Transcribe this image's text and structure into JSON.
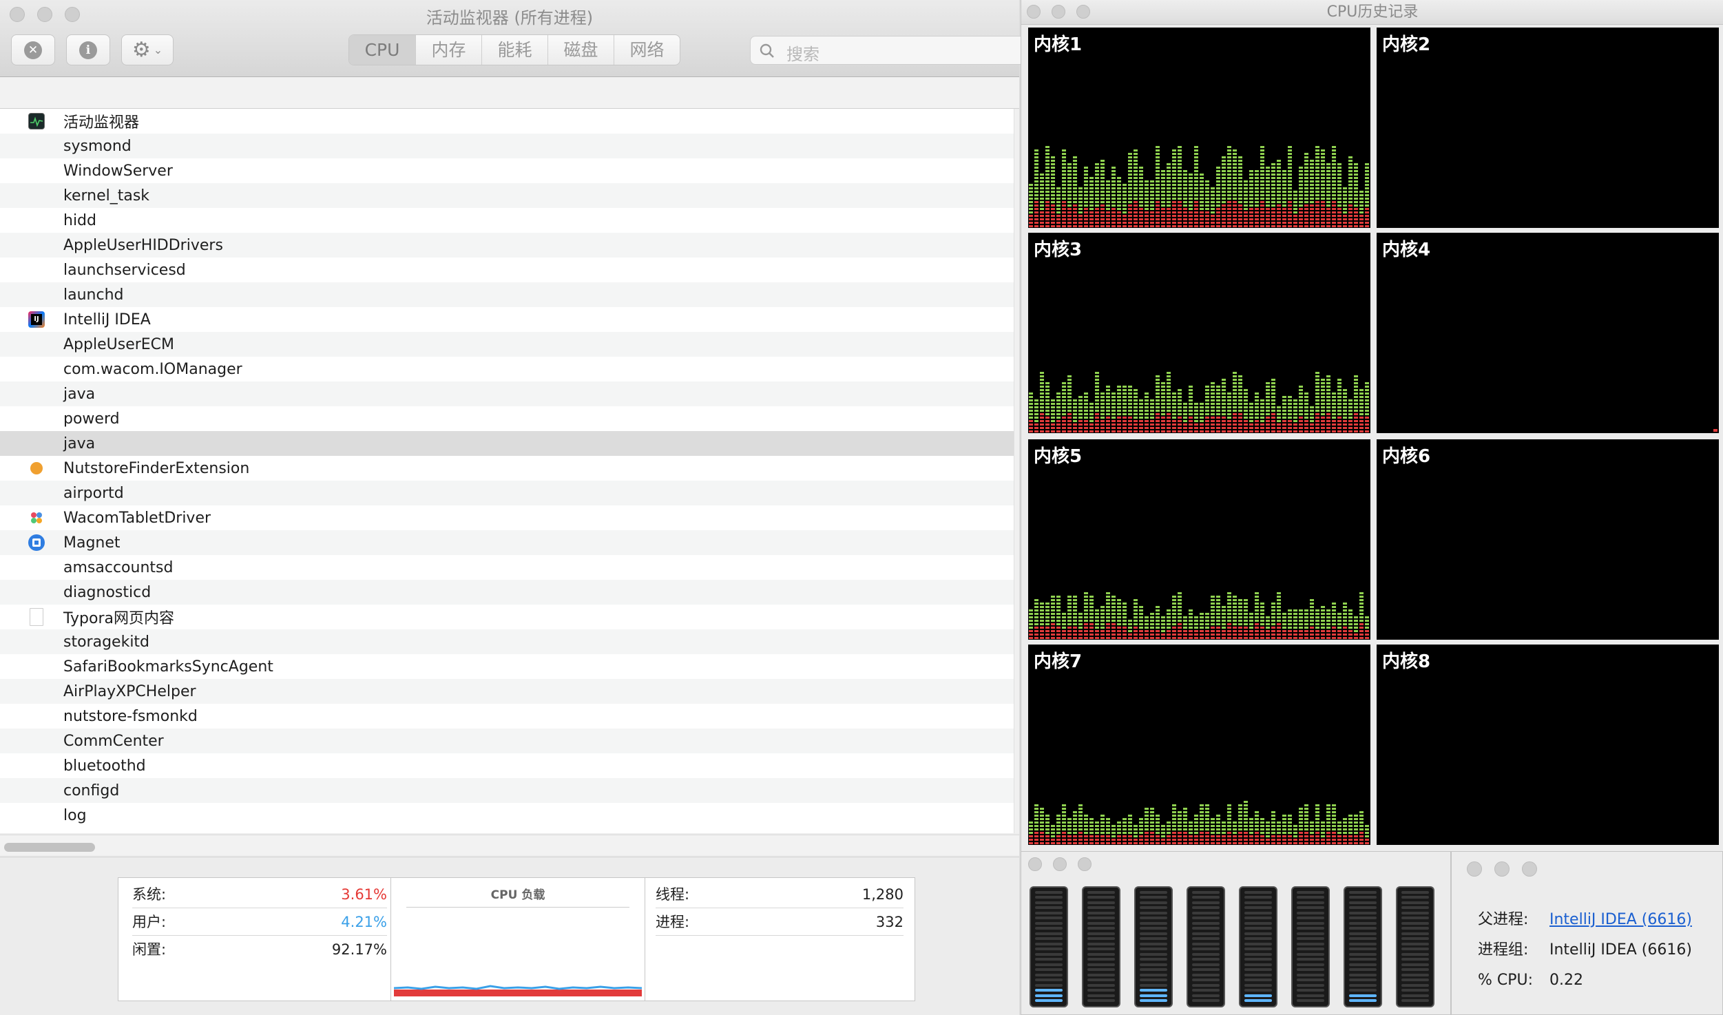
{
  "main_window": {
    "title": "活动监视器 (所有进程)",
    "tabs": [
      {
        "label": "CPU",
        "active": true
      },
      {
        "label": "内存",
        "active": false
      },
      {
        "label": "能耗",
        "active": false
      },
      {
        "label": "磁盘",
        "active": false
      },
      {
        "label": "网络",
        "active": false
      }
    ],
    "search_placeholder": "搜索",
    "processes": [
      {
        "name": "活动监视器",
        "icon": "activity-monitor-icon"
      },
      {
        "name": "sysmond",
        "icon": ""
      },
      {
        "name": "WindowServer",
        "icon": ""
      },
      {
        "name": "kernel_task",
        "icon": ""
      },
      {
        "name": "hidd",
        "icon": ""
      },
      {
        "name": "AppleUserHIDDrivers",
        "icon": ""
      },
      {
        "name": "launchservicesd",
        "icon": ""
      },
      {
        "name": "launchd",
        "icon": ""
      },
      {
        "name": "IntelliJ IDEA",
        "icon": "intellij-icon"
      },
      {
        "name": "AppleUserECM",
        "icon": ""
      },
      {
        "name": "com.wacom.IOManager",
        "icon": ""
      },
      {
        "name": "java",
        "icon": ""
      },
      {
        "name": "powerd",
        "icon": ""
      },
      {
        "name": "java",
        "icon": "",
        "selected": true
      },
      {
        "name": "NutstoreFinderExtension",
        "icon": "nutstore-icon"
      },
      {
        "name": "airportd",
        "icon": ""
      },
      {
        "name": "WacomTabletDriver",
        "icon": "wacom-icon"
      },
      {
        "name": "Magnet",
        "icon": "magnet-icon"
      },
      {
        "name": "amsaccountsd",
        "icon": ""
      },
      {
        "name": "diagnosticd",
        "icon": ""
      },
      {
        "name": "Typora网页内容",
        "icon": "document-icon"
      },
      {
        "name": "storagekitd",
        "icon": ""
      },
      {
        "name": "SafariBookmarksSyncAgent",
        "icon": ""
      },
      {
        "name": "AirPlayXPCHelper",
        "icon": ""
      },
      {
        "name": "nutstore-fsmonkd",
        "icon": ""
      },
      {
        "name": "CommCenter",
        "icon": ""
      },
      {
        "name": "bluetoothd",
        "icon": ""
      },
      {
        "name": "configd",
        "icon": ""
      },
      {
        "name": "log",
        "icon": ""
      }
    ],
    "stats": {
      "system_label": "系统:",
      "system_value": "3.61%",
      "user_label": "用户:",
      "user_value": "4.21%",
      "idle_label": "闲置:",
      "idle_value": "92.17%",
      "cpu_load_title": "CPU 负载",
      "threads_label": "线程:",
      "threads_value": "1,280",
      "processes_label": "进程:",
      "processes_value": "332"
    }
  },
  "cpu_history": {
    "title": "CPU历史记录",
    "cores": [
      {
        "label": "内核1",
        "active": true,
        "level": 0.3
      },
      {
        "label": "内核2",
        "active": false,
        "level": 0
      },
      {
        "label": "内核3",
        "active": true,
        "level": 0.22
      },
      {
        "label": "内核4",
        "active": false,
        "level": 0
      },
      {
        "label": "内核5",
        "active": true,
        "level": 0.17
      },
      {
        "label": "内核6",
        "active": false,
        "level": 0
      },
      {
        "label": "内核7",
        "active": true,
        "level": 0.15
      },
      {
        "label": "内核8",
        "active": false,
        "level": 0
      }
    ]
  },
  "cpu_meter": {
    "levels": [
      0.12,
      0,
      0.12,
      0,
      0.08,
      0,
      0.08,
      0
    ]
  },
  "process_info": {
    "parent_label": "父进程:",
    "parent_value": "IntelliJ IDEA (6616)",
    "group_label": "进程组:",
    "group_value": "IntelliJ IDEA (6616)",
    "cpu_label": "% CPU:",
    "cpu_value": "0.22"
  },
  "colors": {
    "system": "#e53935",
    "user": "#3aa0e8",
    "graph_green": "#8fd14f",
    "graph_red": "#e23b3b",
    "link": "#1a5fd0"
  }
}
